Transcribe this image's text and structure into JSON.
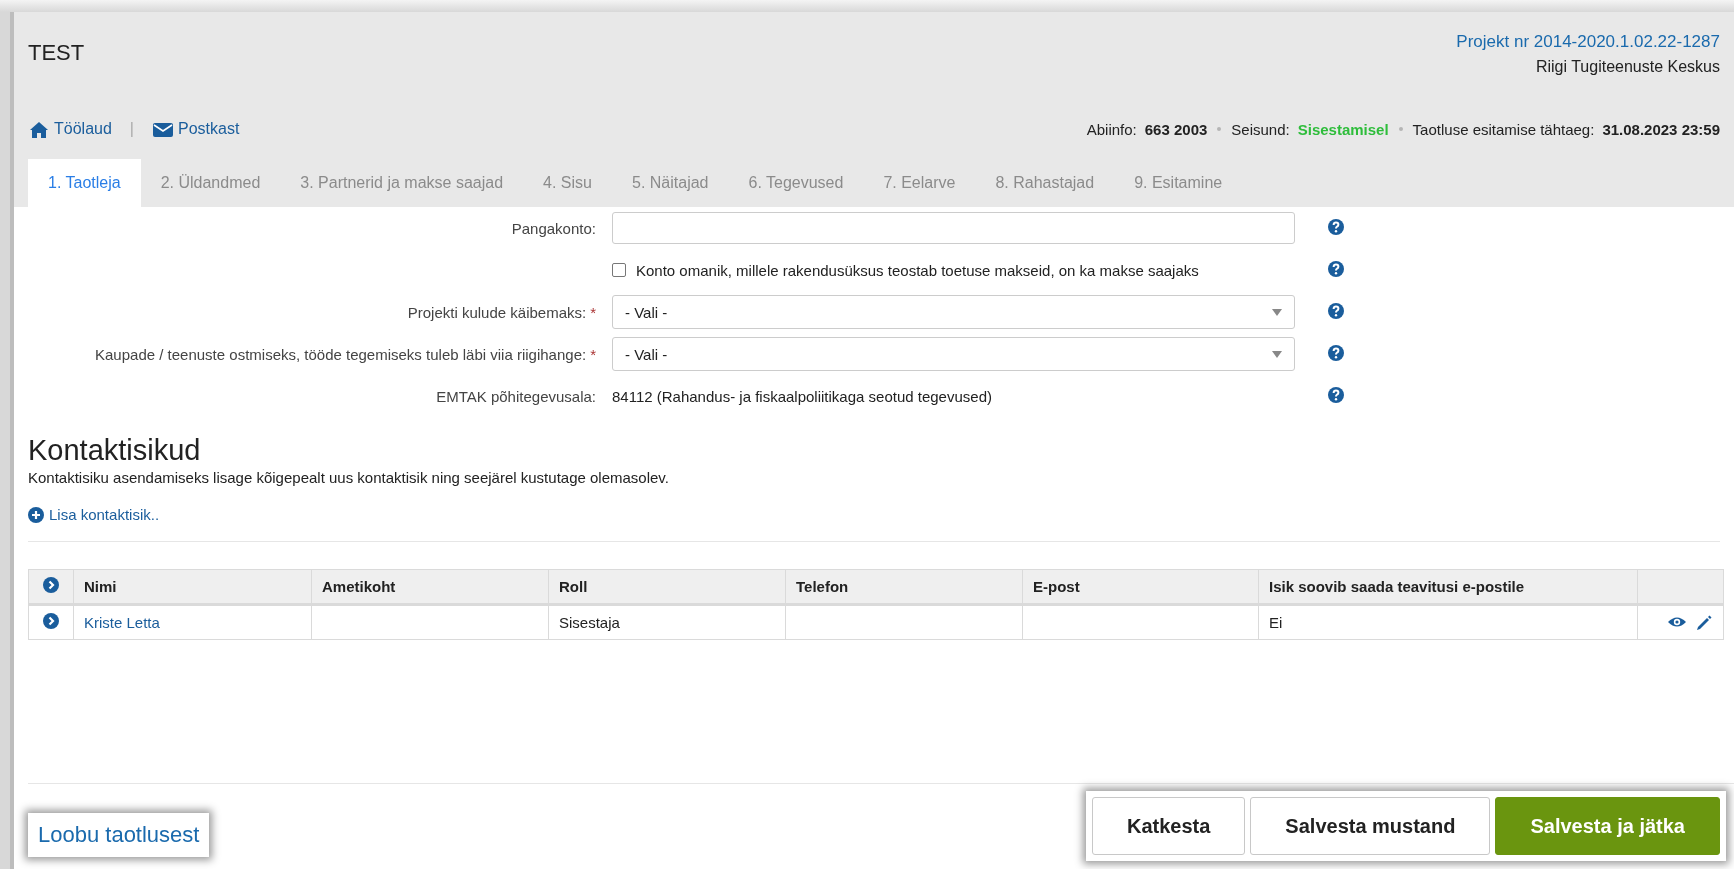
{
  "header": {
    "title": "TEST",
    "project": "Projekt nr 2014-2020.1.02.22-1287",
    "organization": "Riigi Tugiteenuste Keskus",
    "nav": [
      {
        "kind": "home",
        "label": "Töölaud"
      },
      {
        "kind": "mail",
        "label": "Postkast"
      }
    ],
    "nav_separator": "|",
    "info": [
      {
        "label": "Abiinfo:",
        "value": "663 2003",
        "kind": "plain"
      },
      {
        "label": "Seisund:",
        "value": "Sisestamisel",
        "kind": "status"
      },
      {
        "label": "Taotluse esitamise tähtaeg:",
        "value": "31.08.2023 23:59",
        "kind": "plain"
      }
    ]
  },
  "tabs": [
    {
      "label": "1. Taotleja",
      "selected": true
    },
    {
      "label": "2. Üldandmed",
      "selected": false
    },
    {
      "label": "3. Partnerid ja makse saajad",
      "selected": false
    },
    {
      "label": "4. Sisu",
      "selected": false
    },
    {
      "label": "5. Näitajad",
      "selected": false
    },
    {
      "label": "6. Tegevused",
      "selected": false
    },
    {
      "label": "7. Eelarve",
      "selected": false
    },
    {
      "label": "8. Rahastajad",
      "selected": false
    },
    {
      "label": "9. Esitamine",
      "selected": false
    }
  ],
  "form": [
    {
      "kind": "text",
      "label": "Pangakonto:"
    },
    {
      "kind": "checkbox",
      "label": "Konto omanik, millele rakendusüksus teostab toetuse makseid, on ka makse saajaks",
      "checked": false
    },
    {
      "kind": "select",
      "label": "Projekti kulude käibemaks:",
      "marker": "*",
      "value": "- Vali -"
    },
    {
      "kind": "select",
      "label": "Kaupade / teenuste ostmiseks, tööde tegemiseks tuleb läbi viia riigihange:",
      "marker": "*",
      "value": "- Vali -"
    },
    {
      "kind": "static",
      "label": "EMTAK põhitegevusala:",
      "value": "84112 (Rahandus- ja fiskaalpoliitikaga seotud tegevused)"
    }
  ],
  "contacts": {
    "title": "Kontaktisikud",
    "note": "Kontaktisiku asendamiseks lisage kõigepealt uus kontaktisik ning seejärel kustutage olemasolev.",
    "add_link": "Lisa kontaktisik..",
    "columns": [
      "Nimi",
      "Ametikoht",
      "Roll",
      "Telefon",
      "E-post",
      "Isik soovib saada teavitusi e-postile"
    ],
    "rows": [
      {
        "name": "Kriste Letta",
        "role": "Sisestaja",
        "notify": "Ei"
      }
    ]
  },
  "footer": {
    "cancel_link": "Loobu taotlusest",
    "buttons": [
      {
        "label": "Katkesta",
        "kind": "default"
      },
      {
        "label": "Salvesta mustand",
        "kind": "default"
      },
      {
        "label": "Salvesta ja jätka",
        "kind": "primary"
      }
    ]
  }
}
